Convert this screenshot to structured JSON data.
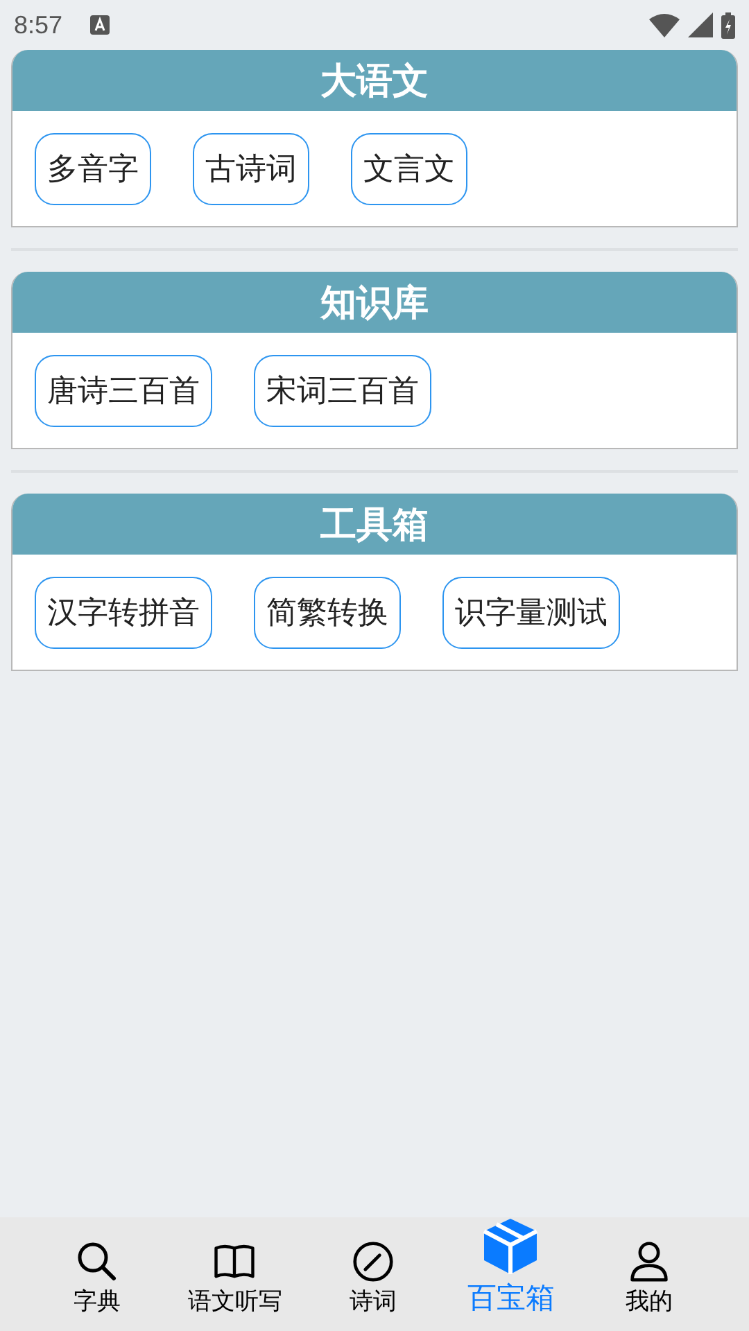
{
  "status_bar": {
    "time": "8:57"
  },
  "sections": [
    {
      "title": "大语文",
      "items": [
        "多音字",
        "古诗词",
        "文言文"
      ]
    },
    {
      "title": "知识库",
      "items": [
        "唐诗三百首",
        "宋词三百首"
      ]
    },
    {
      "title": "工具箱",
      "items": [
        "汉字转拼音",
        "简繁转换",
        "识字量测试"
      ]
    }
  ],
  "tab_bar": [
    {
      "label": "字典",
      "kind": "search",
      "selected": false
    },
    {
      "label": "语文听写",
      "kind": "book",
      "selected": false
    },
    {
      "label": "诗词",
      "kind": "pen",
      "selected": false
    },
    {
      "label": "百宝箱",
      "kind": "box",
      "selected": true
    },
    {
      "label": "我的",
      "kind": "person",
      "selected": false
    }
  ]
}
